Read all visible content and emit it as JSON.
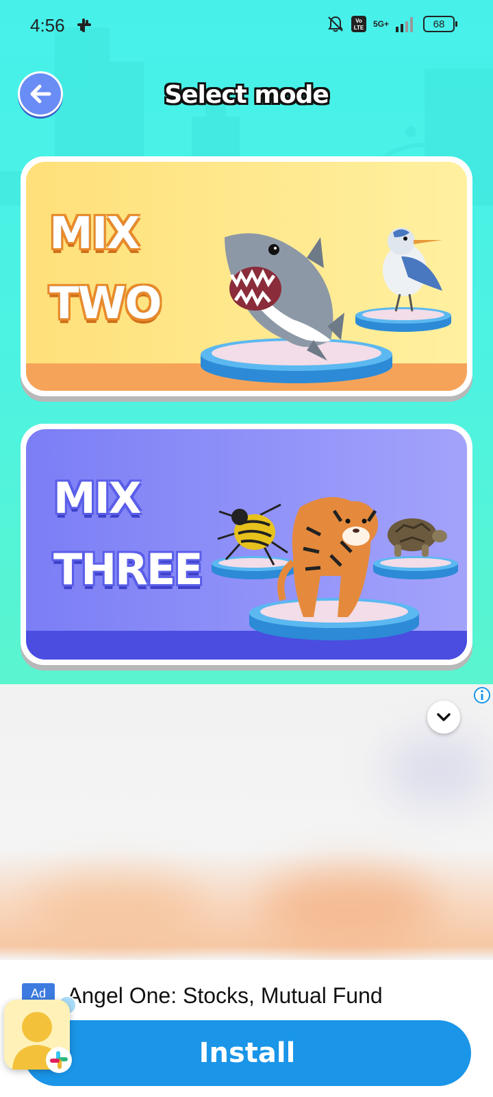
{
  "status_bar": {
    "time": "4:56",
    "network": "5G+",
    "volte": "Vo\nLTE",
    "battery": "68"
  },
  "header": {
    "title": "Select mode"
  },
  "modes": [
    {
      "line1": "MIX",
      "line2": "TWO",
      "color": "#ffe07a"
    },
    {
      "line1": "MIX",
      "line2": "THREE",
      "color": "#7b7ef5"
    }
  ],
  "ad": {
    "badge": "Ad",
    "headline": "Angel One: Stocks, Mutual Fund",
    "install_label": "Install",
    "button_color": "#1a95e8"
  },
  "colors": {
    "background": "#47f1ea",
    "accent_blue": "#1a95e8"
  }
}
